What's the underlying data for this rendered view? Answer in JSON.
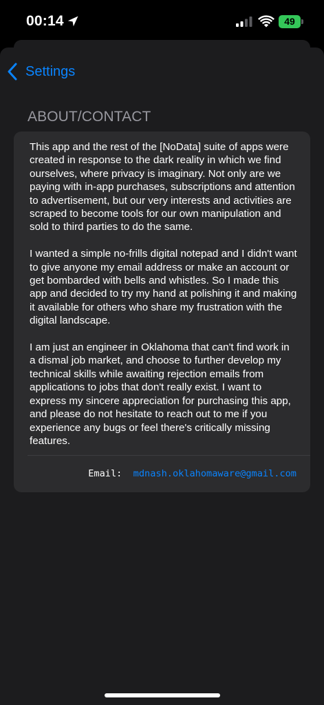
{
  "status_bar": {
    "time": "00:14",
    "battery_level": "49",
    "battery_color": "#34c759",
    "icons": [
      "location-arrow-icon",
      "cellular-signal-icon",
      "wifi-icon",
      "battery-charging-icon"
    ]
  },
  "nav": {
    "back_label": "Settings",
    "back_icon": "chevron-left-icon",
    "accent_color": "#0a84ff"
  },
  "section": {
    "header": "ABOUT/CONTACT"
  },
  "about": {
    "paragraphs": [
      "This app and the rest of the [NoData] suite of apps were created in response to the dark reality in which we find ourselves, where privacy is imaginary. Not only are we paying with in-app purchases, subscriptions and attention to advertisement, but our very interests and activities are scraped to become tools for our own manipulation and sold to third parties to do the same.",
      "I wanted a simple no-frills digital notepad and I didn't want to give anyone my email address or make an account or get bombarded with bells and whistles.  So I made this app and decided to try my hand at polishing it and making it available for others who share my frustration with the digital landscape.",
      "I am just an engineer in Oklahoma that can't find work in a dismal job market, and choose to further develop my technical skills while awaiting rejection emails from applications to jobs that don't really exist.  I want to express my sincere appreciation for purchasing this app, and please do not hesitate to reach out to me if you experience any bugs or feel there's critically missing features."
    ]
  },
  "contact": {
    "email_label": "Email:",
    "email_address": "mdnash.oklahomaware@gmail.com"
  }
}
